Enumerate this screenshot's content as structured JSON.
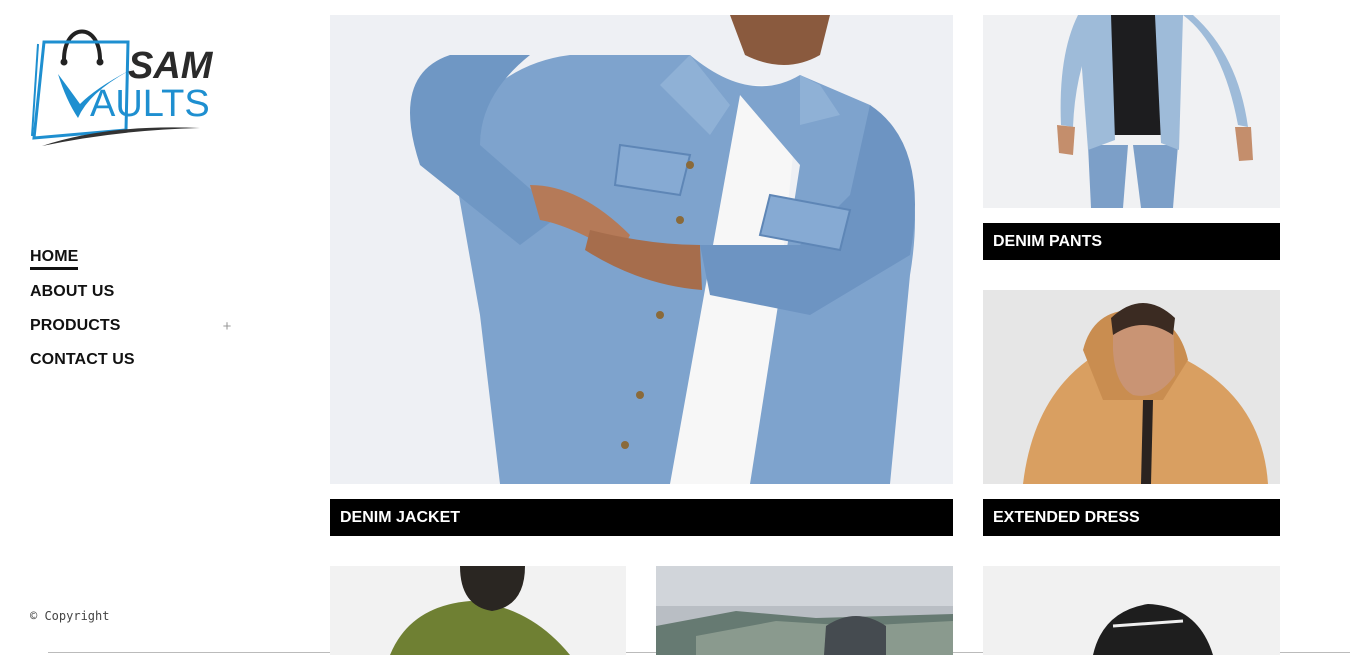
{
  "brand": {
    "line1": "SAM",
    "line2": "AULTS",
    "accent": "#1e8fd0"
  },
  "nav": {
    "items": [
      {
        "label": "HOME",
        "active": true,
        "expandable": false
      },
      {
        "label": "ABOUT US",
        "active": false,
        "expandable": false
      },
      {
        "label": "PRODUCTS",
        "active": false,
        "expandable": true,
        "expand_icon": "+"
      },
      {
        "label": "CONTACT US",
        "active": false,
        "expandable": false
      }
    ]
  },
  "footer": {
    "copyright": "© Copyright"
  },
  "products": [
    {
      "caption": "DENIM JACKET",
      "image": "man-in-denim-jacket"
    },
    {
      "caption": "DENIM PANTS",
      "image": "man-in-denim-jacket-and-jeans"
    },
    {
      "caption": "EXTENDED DRESS",
      "image": "man-in-orange-sherpa-hoodie"
    },
    {
      "caption": "",
      "image": "man-in-green-hoodie-back"
    },
    {
      "caption": "",
      "image": "backpack-on-coastal-cliff"
    },
    {
      "caption": "",
      "image": "black-cap"
    }
  ]
}
